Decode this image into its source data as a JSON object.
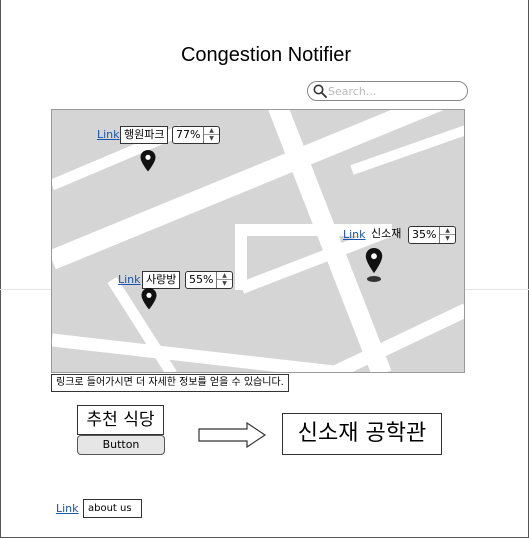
{
  "app": {
    "title": "Congestion Notifier"
  },
  "search": {
    "placeholder": "Search..."
  },
  "map": {
    "places": [
      {
        "link_label": "Link",
        "name": "행원파크",
        "congestion": "77%",
        "congestion_value": 77,
        "marker_icon": "map-pin-icon"
      },
      {
        "link_label": "Link",
        "name": "신소재",
        "congestion": "35%",
        "congestion_value": 35,
        "marker_icon": "map-pin-icon"
      },
      {
        "link_label": "Link",
        "name": "사랑방",
        "congestion": "55%",
        "congestion_value": 55,
        "marker_icon": "map-pin-icon"
      }
    ]
  },
  "info_text": "링크로 들어가시면 더 자세한 정보를 얻을 수 있습니다.",
  "recommend": {
    "label": "추천 식당",
    "button_label": "Button",
    "destination": "신소재 공학관"
  },
  "footer": {
    "link_label": "Link",
    "about_label": "about us"
  },
  "colors": {
    "map_background": "#d5d5d5",
    "road": "#ffffff",
    "link": "#1a55b0"
  }
}
